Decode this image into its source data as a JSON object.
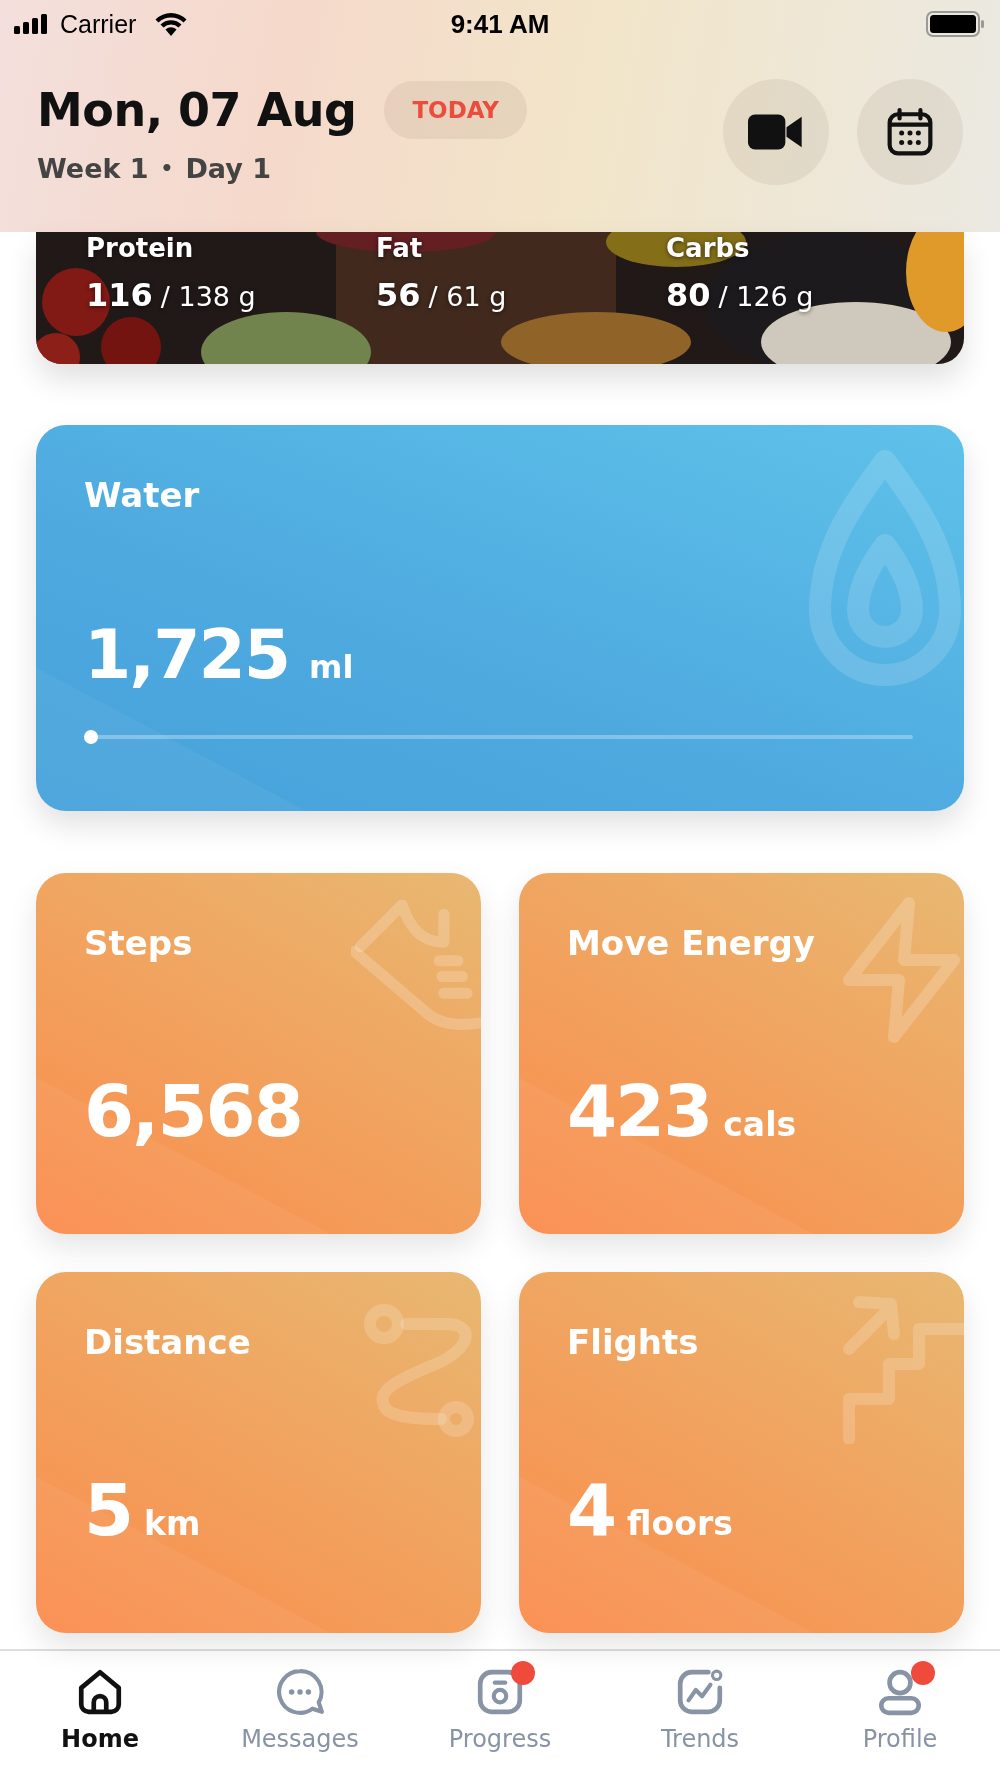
{
  "status_bar": {
    "carrier": "Carrier",
    "time": "9:41 AM"
  },
  "header": {
    "date": "Mon, 07 Aug",
    "badge": "TODAY",
    "week": "Week 1",
    "separator": "•",
    "day": "Day 1"
  },
  "macros": [
    {
      "name": "Protein",
      "value": "116",
      "target": "/ 138 g"
    },
    {
      "name": "Fat",
      "value": "56",
      "target": "/ 61 g"
    },
    {
      "name": "Carbs",
      "value": "80",
      "target": "/ 126 g"
    }
  ],
  "water": {
    "title": "Water",
    "value": "1,725",
    "unit": "ml",
    "level": 0
  },
  "metrics": [
    {
      "kind": "steps",
      "title": "Steps",
      "value": "6,568"
    },
    {
      "kind": "energy",
      "title": "Move Energy",
      "value": "423",
      "unit": "cals"
    },
    {
      "kind": "distance",
      "title": "Distance",
      "value": "5",
      "unit": "km"
    },
    {
      "kind": "flights",
      "title": "Flights",
      "value": "4",
      "unit": "floors"
    }
  ],
  "tabs": [
    {
      "kind": "home",
      "label": "Home",
      "selected": true,
      "badge": false
    },
    {
      "kind": "messages",
      "label": "Messages",
      "selected": false,
      "badge": false
    },
    {
      "kind": "progress",
      "label": "Progress",
      "selected": false,
      "badge": true
    },
    {
      "kind": "trends",
      "label": "Trends",
      "selected": false,
      "badge": false
    },
    {
      "kind": "profile",
      "label": "Profile",
      "selected": false,
      "badge": true
    }
  ]
}
